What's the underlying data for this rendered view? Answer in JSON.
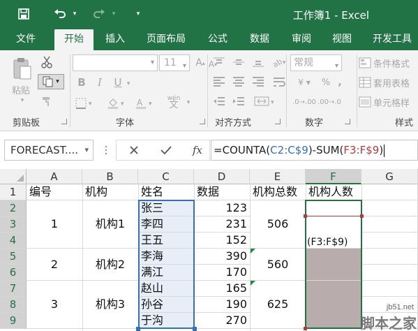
{
  "window": {
    "title": "工作簿1 - Excel"
  },
  "tabs": [
    {
      "label": "文件"
    },
    {
      "label": "开始"
    },
    {
      "label": "插入"
    },
    {
      "label": "页面布局"
    },
    {
      "label": "公式"
    },
    {
      "label": "数据"
    },
    {
      "label": "审阅"
    },
    {
      "label": "视图"
    },
    {
      "label": "开发工具"
    }
  ],
  "active_tab": "开始",
  "ribbon": {
    "clipboard": {
      "label": "剪贴板",
      "paste_label": "粘贴"
    },
    "font": {
      "label": "字体",
      "font_name": "",
      "font_size": "11",
      "bold": "B",
      "italic": "I",
      "underline": "U",
      "phonetic": "wén"
    },
    "alignment": {
      "label": "对齐方式"
    },
    "number": {
      "label": "数字",
      "format": "常规"
    },
    "styles": {
      "label": "样式",
      "conditional": "条件格式",
      "table": "套用表格",
      "cell_styles": "单元格样"
    }
  },
  "formula_bar": {
    "name_box": "FORECAST....",
    "fx": "fx",
    "formula_prefix": "=COUNTA(",
    "ref1": "C2:C$9",
    "formula_mid": ")-SUM(",
    "ref2": "F3:F$9",
    "formula_suffix": ")"
  },
  "columns": [
    "A",
    "B",
    "C",
    "D",
    "E",
    "F",
    "G"
  ],
  "rows": [
    "1",
    "2",
    "3",
    "4",
    "5",
    "6",
    "7",
    "8",
    "9"
  ],
  "sheet": {
    "headers": {
      "A1": "编号",
      "B1": "机构",
      "C1": "姓名",
      "D1": "数据",
      "E1": "机构总数",
      "F1": "机构人数"
    },
    "groups": [
      {
        "id": "1",
        "org": "机构1",
        "total": "506"
      },
      {
        "id": "2",
        "org": "机构2",
        "total": "560"
      },
      {
        "id": "3",
        "org": "机构3",
        "total": "625"
      }
    ],
    "names": [
      "张三",
      "李四",
      "王五",
      "李海",
      "满江",
      "赵山",
      "孙谷",
      "于沟"
    ],
    "values": [
      "123",
      "231",
      "152",
      "390",
      "170",
      "165",
      "190",
      "270"
    ],
    "edit_hint": "(F3:F$9)"
  },
  "watermark": {
    "site": "jb51.net",
    "brand": "脚本之家"
  },
  "colors": {
    "excel_green": "#217346",
    "ref_blue": "#3770b8",
    "ref_red": "#b03c3c",
    "merged_fill": "#b8acac",
    "range_fill": "#e8eef7"
  }
}
